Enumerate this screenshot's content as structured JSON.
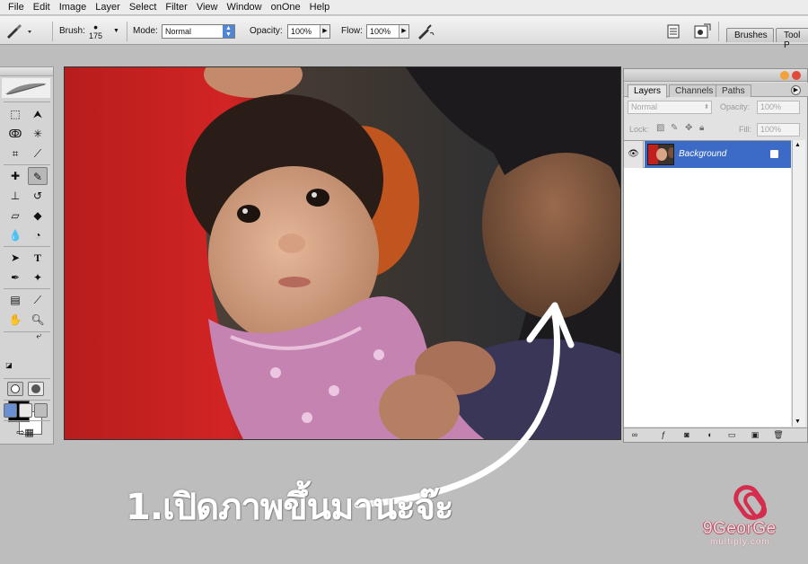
{
  "menu": [
    "File",
    "Edit",
    "Image",
    "Layer",
    "Select",
    "Filter",
    "View",
    "Window",
    "onOne",
    "Help"
  ],
  "options_bar": {
    "brush_label": "Brush:",
    "brush_size": "175",
    "mode_label": "Mode:",
    "mode_value": "Normal",
    "opacity_label": "Opacity:",
    "opacity_value": "100%",
    "flow_label": "Flow:",
    "flow_value": "100%",
    "tab_brushes": "Brushes",
    "tab_tool_presets": "Tool P"
  },
  "layers_panel": {
    "tabs": [
      "Layers",
      "Channels",
      "Paths"
    ],
    "blend_mode": "Normal",
    "opacity_label": "Opacity:",
    "opacity_value": "100%",
    "lock_label": "Lock:",
    "fill_label": "Fill:",
    "fill_value": "100%",
    "layer_name": "Background"
  },
  "caption": "1.เปิดภาพขึ้นมานะจ๊ะ",
  "watermark": {
    "name": "9GeorGe",
    "site": "multiply.com",
    "color": "#d42d4e"
  },
  "colors": {
    "foreground": "#000000",
    "background": "#ffffff",
    "selection": "#3b6bc6"
  }
}
